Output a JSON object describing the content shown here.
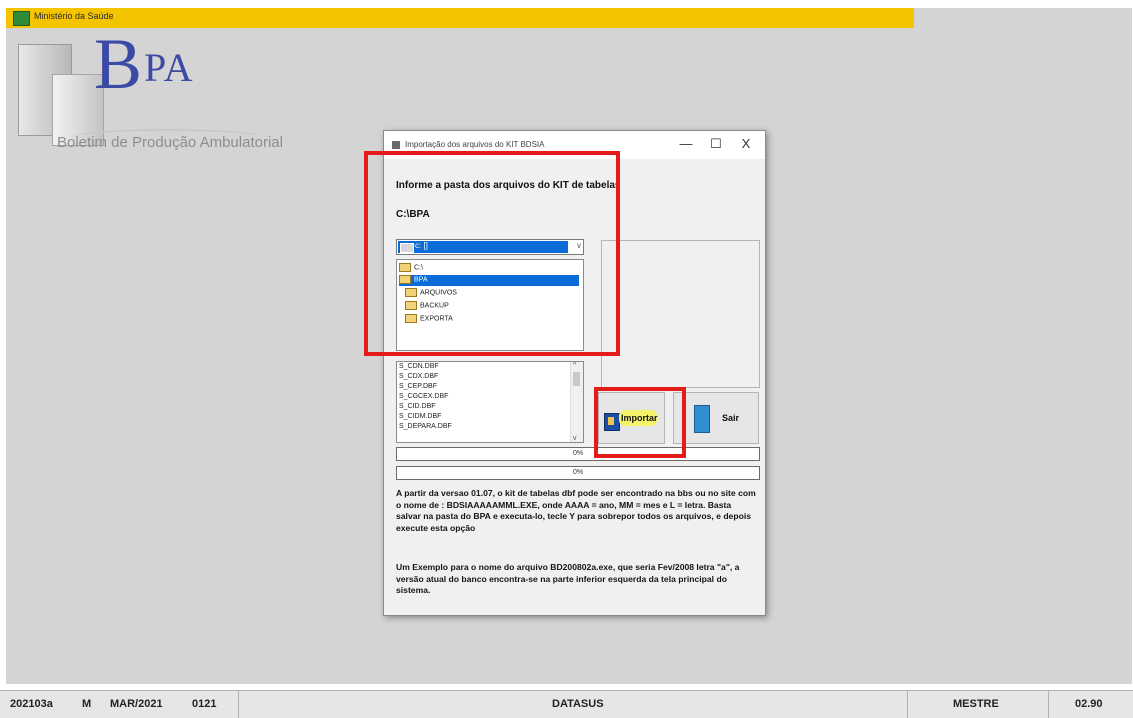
{
  "app": {
    "title": "Ministério da Saúde"
  },
  "logo": {
    "big": "B",
    "small": "PA",
    "subtitle": "Boletim de Produção Ambulatorial"
  },
  "dialog": {
    "title": "Importação dos arquivos do KIT BDSIA",
    "buttons": {
      "minimize": "—",
      "maximize": "☐",
      "close": "X"
    },
    "prompt": "Informe a pasta dos arquivos do KIT de tabelas",
    "path": "C:\\BPA",
    "drive": {
      "value": "c: []",
      "arrow": "v"
    },
    "folders": [
      "C:\\",
      "BPA",
      "ARQUIVOS",
      "BACKUP",
      "EXPORTA"
    ],
    "selected_folder": "BPA",
    "files": [
      "S_CDN.DBF",
      "S_CDX.DBF",
      "S_CEP.DBF",
      "S_CGCEX.DBF",
      "S_CID.DBF",
      "S_CIDM.DBF",
      "S_DEPARA.DBF"
    ],
    "import_button": "Importar",
    "exit_button": "Sair",
    "progress": [
      "0%",
      "0%"
    ],
    "note1": "A partir da versao 01.07, o kit de tabelas dbf pode ser encontrado na bbs ou no site com o nome de : BDSIAAAAAMML.EXE, onde AAAA = ano, MM = mes e L = letra. Basta salvar na pasta do BPA e executa-lo, tecle Y para sobrepor todos os arquivos, e depois execute esta opção",
    "note2": "Um Exemplo para o nome do arquivo BD200802a.exe, que seria Fev/2008 letra \"a\", a versão atual do banco encontra-se na parte inferior esquerda da tela principal do sistema."
  },
  "statusbar": {
    "version_db": "202103a",
    "mode": "M",
    "period": "MAR/2021",
    "code": "0121",
    "center": "DATASUS",
    "user": "MESTRE",
    "version": "02.90"
  },
  "colors": {
    "topbar": "#f5c400",
    "highlight": "#e31b1b",
    "selection": "#0a6cd6",
    "logo_blue": "#3b4aa5"
  }
}
